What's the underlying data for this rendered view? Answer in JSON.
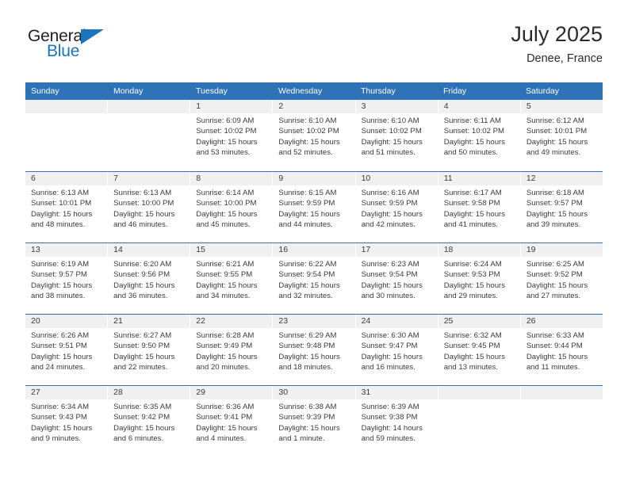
{
  "brand": {
    "name_part1": "General",
    "name_part2": "Blue",
    "accent_color": "#1b75bc"
  },
  "header": {
    "title": "July 2025",
    "subtitle": "Denee, France"
  },
  "theme": {
    "header_blue": "#2e72b8",
    "band_gray": "#f0f0f0",
    "text": "#3a3a3a"
  },
  "weekdays": [
    "Sunday",
    "Monday",
    "Tuesday",
    "Wednesday",
    "Thursday",
    "Friday",
    "Saturday"
  ],
  "weeks": [
    [
      {
        "day": "",
        "blank": true,
        "sunrise": "",
        "sunset": "",
        "daylight1": "",
        "daylight2": ""
      },
      {
        "day": "",
        "blank": true,
        "sunrise": "",
        "sunset": "",
        "daylight1": "",
        "daylight2": ""
      },
      {
        "day": "1",
        "sunrise": "Sunrise: 6:09 AM",
        "sunset": "Sunset: 10:02 PM",
        "daylight1": "Daylight: 15 hours",
        "daylight2": "and 53 minutes."
      },
      {
        "day": "2",
        "sunrise": "Sunrise: 6:10 AM",
        "sunset": "Sunset: 10:02 PM",
        "daylight1": "Daylight: 15 hours",
        "daylight2": "and 52 minutes."
      },
      {
        "day": "3",
        "sunrise": "Sunrise: 6:10 AM",
        "sunset": "Sunset: 10:02 PM",
        "daylight1": "Daylight: 15 hours",
        "daylight2": "and 51 minutes."
      },
      {
        "day": "4",
        "sunrise": "Sunrise: 6:11 AM",
        "sunset": "Sunset: 10:02 PM",
        "daylight1": "Daylight: 15 hours",
        "daylight2": "and 50 minutes."
      },
      {
        "day": "5",
        "sunrise": "Sunrise: 6:12 AM",
        "sunset": "Sunset: 10:01 PM",
        "daylight1": "Daylight: 15 hours",
        "daylight2": "and 49 minutes."
      }
    ],
    [
      {
        "day": "6",
        "sunrise": "Sunrise: 6:13 AM",
        "sunset": "Sunset: 10:01 PM",
        "daylight1": "Daylight: 15 hours",
        "daylight2": "and 48 minutes."
      },
      {
        "day": "7",
        "sunrise": "Sunrise: 6:13 AM",
        "sunset": "Sunset: 10:00 PM",
        "daylight1": "Daylight: 15 hours",
        "daylight2": "and 46 minutes."
      },
      {
        "day": "8",
        "sunrise": "Sunrise: 6:14 AM",
        "sunset": "Sunset: 10:00 PM",
        "daylight1": "Daylight: 15 hours",
        "daylight2": "and 45 minutes."
      },
      {
        "day": "9",
        "sunrise": "Sunrise: 6:15 AM",
        "sunset": "Sunset: 9:59 PM",
        "daylight1": "Daylight: 15 hours",
        "daylight2": "and 44 minutes."
      },
      {
        "day": "10",
        "sunrise": "Sunrise: 6:16 AM",
        "sunset": "Sunset: 9:59 PM",
        "daylight1": "Daylight: 15 hours",
        "daylight2": "and 42 minutes."
      },
      {
        "day": "11",
        "sunrise": "Sunrise: 6:17 AM",
        "sunset": "Sunset: 9:58 PM",
        "daylight1": "Daylight: 15 hours",
        "daylight2": "and 41 minutes."
      },
      {
        "day": "12",
        "sunrise": "Sunrise: 6:18 AM",
        "sunset": "Sunset: 9:57 PM",
        "daylight1": "Daylight: 15 hours",
        "daylight2": "and 39 minutes."
      }
    ],
    [
      {
        "day": "13",
        "sunrise": "Sunrise: 6:19 AM",
        "sunset": "Sunset: 9:57 PM",
        "daylight1": "Daylight: 15 hours",
        "daylight2": "and 38 minutes."
      },
      {
        "day": "14",
        "sunrise": "Sunrise: 6:20 AM",
        "sunset": "Sunset: 9:56 PM",
        "daylight1": "Daylight: 15 hours",
        "daylight2": "and 36 minutes."
      },
      {
        "day": "15",
        "sunrise": "Sunrise: 6:21 AM",
        "sunset": "Sunset: 9:55 PM",
        "daylight1": "Daylight: 15 hours",
        "daylight2": "and 34 minutes."
      },
      {
        "day": "16",
        "sunrise": "Sunrise: 6:22 AM",
        "sunset": "Sunset: 9:54 PM",
        "daylight1": "Daylight: 15 hours",
        "daylight2": "and 32 minutes."
      },
      {
        "day": "17",
        "sunrise": "Sunrise: 6:23 AM",
        "sunset": "Sunset: 9:54 PM",
        "daylight1": "Daylight: 15 hours",
        "daylight2": "and 30 minutes."
      },
      {
        "day": "18",
        "sunrise": "Sunrise: 6:24 AM",
        "sunset": "Sunset: 9:53 PM",
        "daylight1": "Daylight: 15 hours",
        "daylight2": "and 29 minutes."
      },
      {
        "day": "19",
        "sunrise": "Sunrise: 6:25 AM",
        "sunset": "Sunset: 9:52 PM",
        "daylight1": "Daylight: 15 hours",
        "daylight2": "and 27 minutes."
      }
    ],
    [
      {
        "day": "20",
        "sunrise": "Sunrise: 6:26 AM",
        "sunset": "Sunset: 9:51 PM",
        "daylight1": "Daylight: 15 hours",
        "daylight2": "and 24 minutes."
      },
      {
        "day": "21",
        "sunrise": "Sunrise: 6:27 AM",
        "sunset": "Sunset: 9:50 PM",
        "daylight1": "Daylight: 15 hours",
        "daylight2": "and 22 minutes."
      },
      {
        "day": "22",
        "sunrise": "Sunrise: 6:28 AM",
        "sunset": "Sunset: 9:49 PM",
        "daylight1": "Daylight: 15 hours",
        "daylight2": "and 20 minutes."
      },
      {
        "day": "23",
        "sunrise": "Sunrise: 6:29 AM",
        "sunset": "Sunset: 9:48 PM",
        "daylight1": "Daylight: 15 hours",
        "daylight2": "and 18 minutes."
      },
      {
        "day": "24",
        "sunrise": "Sunrise: 6:30 AM",
        "sunset": "Sunset: 9:47 PM",
        "daylight1": "Daylight: 15 hours",
        "daylight2": "and 16 minutes."
      },
      {
        "day": "25",
        "sunrise": "Sunrise: 6:32 AM",
        "sunset": "Sunset: 9:45 PM",
        "daylight1": "Daylight: 15 hours",
        "daylight2": "and 13 minutes."
      },
      {
        "day": "26",
        "sunrise": "Sunrise: 6:33 AM",
        "sunset": "Sunset: 9:44 PM",
        "daylight1": "Daylight: 15 hours",
        "daylight2": "and 11 minutes."
      }
    ],
    [
      {
        "day": "27",
        "sunrise": "Sunrise: 6:34 AM",
        "sunset": "Sunset: 9:43 PM",
        "daylight1": "Daylight: 15 hours",
        "daylight2": "and 9 minutes."
      },
      {
        "day": "28",
        "sunrise": "Sunrise: 6:35 AM",
        "sunset": "Sunset: 9:42 PM",
        "daylight1": "Daylight: 15 hours",
        "daylight2": "and 6 minutes."
      },
      {
        "day": "29",
        "sunrise": "Sunrise: 6:36 AM",
        "sunset": "Sunset: 9:41 PM",
        "daylight1": "Daylight: 15 hours",
        "daylight2": "and 4 minutes."
      },
      {
        "day": "30",
        "sunrise": "Sunrise: 6:38 AM",
        "sunset": "Sunset: 9:39 PM",
        "daylight1": "Daylight: 15 hours",
        "daylight2": "and 1 minute."
      },
      {
        "day": "31",
        "sunrise": "Sunrise: 6:39 AM",
        "sunset": "Sunset: 9:38 PM",
        "daylight1": "Daylight: 14 hours",
        "daylight2": "and 59 minutes."
      },
      {
        "day": "",
        "blank": true,
        "sunrise": "",
        "sunset": "",
        "daylight1": "",
        "daylight2": ""
      },
      {
        "day": "",
        "blank": true,
        "sunrise": "",
        "sunset": "",
        "daylight1": "",
        "daylight2": ""
      }
    ]
  ]
}
